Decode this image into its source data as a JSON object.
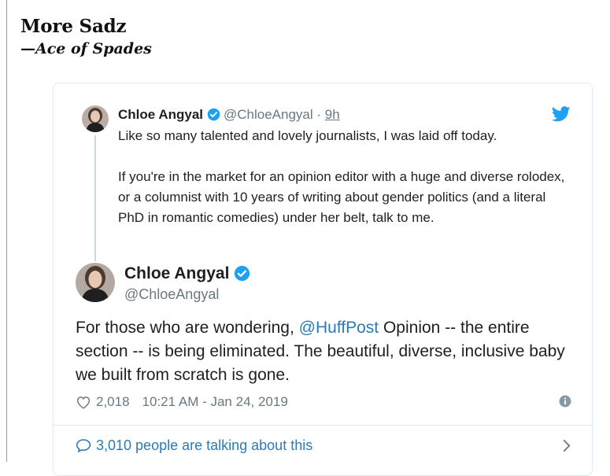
{
  "post": {
    "title": "More Sadz",
    "byline": "—Ace of Spades"
  },
  "quoted_tweet": {
    "name": "Chloe Angyal",
    "handle": "@ChloeAngyal",
    "separator": "·",
    "time": "9h",
    "paragraphs": [
      "Like so many talented and lovely journalists, I was laid off today.",
      "If you're in the market for an opinion editor with a huge and diverse rolodex, or a columnist with 10 years of writing about gender politics (and a literal PhD in romantic comedies) under her belt, talk to me."
    ]
  },
  "main_tweet": {
    "name": "Chloe Angyal",
    "handle": "@ChloeAngyal",
    "body_before": "For those who are wondering, ",
    "mention": "@HuffPost",
    "body_after": " Opinion -- the entire section -- is being eliminated. The beautiful, diverse, inclusive baby we built from scratch is gone.",
    "likes": "2,018",
    "timestamp": "10:21 AM - Jan 24, 2019"
  },
  "footer": {
    "talking": "3,010 people are talking about this"
  },
  "icons": {
    "brand": "twitter-bird-icon",
    "verified": "verified-badge-icon",
    "like": "heart-icon",
    "info": "info-icon",
    "talking": "speech-bubble-icon",
    "expand": "chevron-right-icon"
  },
  "colors": {
    "twitter_blue": "#1da1f2",
    "link_blue": "#2b7bb9",
    "muted": "#697882",
    "text": "#1c2022",
    "border": "#e1e8ed"
  }
}
